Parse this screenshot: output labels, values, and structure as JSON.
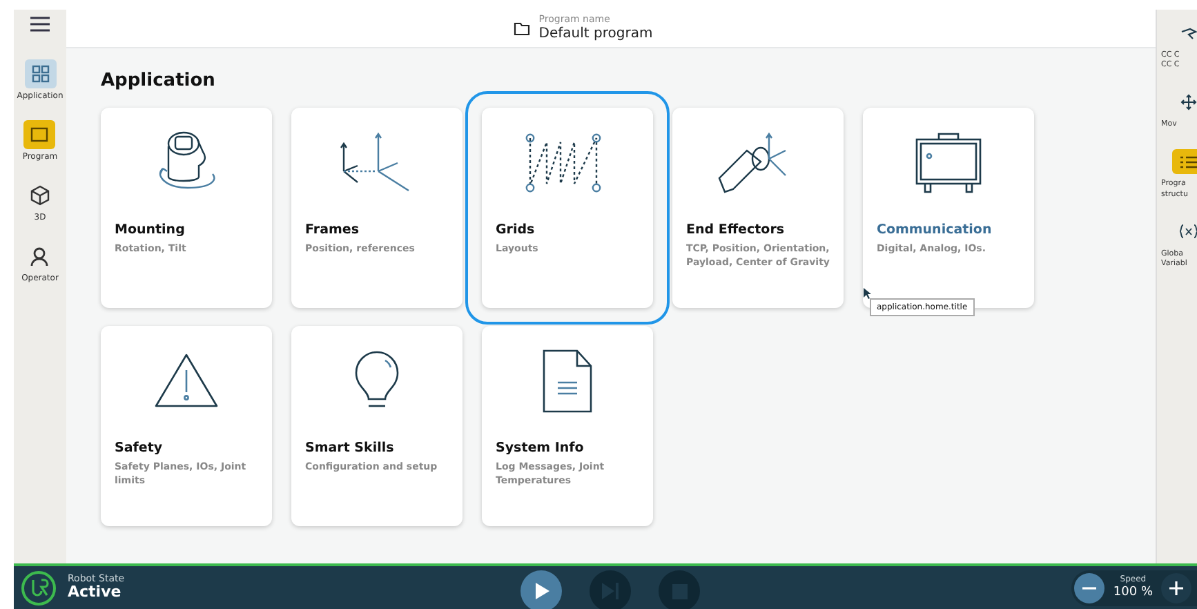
{
  "header": {
    "label": "Program name",
    "value": "Default program"
  },
  "nav": [
    {
      "label": "Application",
      "selected": true,
      "highlighted": false
    },
    {
      "label": "Program",
      "selected": false,
      "highlighted": true
    },
    {
      "label": "3D",
      "selected": false,
      "highlighted": false
    },
    {
      "label": "Operator",
      "selected": false,
      "highlighted": false
    }
  ],
  "title": "Application",
  "cards": [
    {
      "title": "Mounting",
      "subtitle": "Rotation, Tilt",
      "selected": false,
      "hovered": false
    },
    {
      "title": "Frames",
      "subtitle": "Position, references",
      "selected": false,
      "hovered": false
    },
    {
      "title": "Grids",
      "subtitle": "Layouts",
      "selected": true,
      "hovered": false
    },
    {
      "title": "End Effectors",
      "subtitle": "TCP, Position, Orientation, Payload, Center of Gravity",
      "selected": false,
      "hovered": false
    },
    {
      "title": "Communication",
      "subtitle": "Digital, Analog, IOs.",
      "selected": false,
      "hovered": true
    },
    {
      "title": "Safety",
      "subtitle": "Safety Planes, IOs, Joint limits",
      "selected": false,
      "hovered": false
    },
    {
      "title": "Smart Skills",
      "subtitle": "Configuration and setup",
      "selected": false,
      "hovered": false
    },
    {
      "title": "System Info",
      "subtitle": "Log Messages, Joint Temperatures",
      "selected": false,
      "hovered": false
    }
  ],
  "tooltip": "application.home.title",
  "right_panel": [
    {
      "lines": [
        "CC C",
        "CC C"
      ],
      "highlighted": false
    },
    {
      "lines": [
        "Mov"
      ],
      "highlighted": false
    },
    {
      "lines": [
        "Progra",
        "structu"
      ],
      "highlighted": true
    },
    {
      "lines": [
        "Globa",
        "Variabl"
      ],
      "highlighted": false
    }
  ],
  "status_bar": {
    "label": "Robot State",
    "state": "Active",
    "speed_label": "Speed",
    "speed": "100 %"
  }
}
